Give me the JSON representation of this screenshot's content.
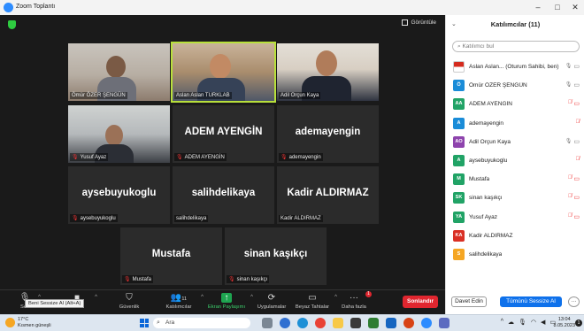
{
  "window": {
    "title": "Zoom Toplantı"
  },
  "meeting": {
    "view_label": "Görüntüle",
    "tiles": [
      {
        "id": "t1",
        "label": "Ömür ÖZER ŞENGÜN",
        "video": true
      },
      {
        "id": "t2",
        "label": "Aslan Aslan TURKLAB",
        "video": true,
        "active": true
      },
      {
        "id": "t3",
        "label": "Adil Orçun Kaya",
        "video": true
      },
      {
        "id": "t4",
        "label": "Yusuf Ayaz",
        "video": true,
        "muted": true
      },
      {
        "id": "t5",
        "big": "ADEM AYENGİN",
        "label": "ADEM AYENGİN",
        "muted": true
      },
      {
        "id": "t6",
        "big": "ademayengin",
        "label": "ademayengin",
        "muted": true
      },
      {
        "id": "t7",
        "big": "aysebuyukoglu",
        "label": "aysebuyukoglu",
        "muted": true
      },
      {
        "id": "t8",
        "big": "salihdelikaya",
        "label": "salihdelikaya"
      },
      {
        "id": "t9",
        "big": "Kadir ALDIRMAZ",
        "label": "Kadir ALDIRMAZ"
      },
      {
        "id": "t10",
        "big": "Mustafa",
        "label": "Mustafa",
        "muted": true
      },
      {
        "id": "t11",
        "big": "sinan kaşıkçı",
        "label": "sinan kaşıkçı",
        "muted": true
      }
    ]
  },
  "toolbar": {
    "mute_label": "Ses",
    "video_label": "or",
    "tooltip": "Beni Sessize Al (Alt+A)",
    "security_label": "Güvenlik",
    "participants_label": "Katılımcılar",
    "participants_count": "11",
    "share_label": "Ekran Paylaşımı",
    "apps_label": "Uygulamalar",
    "whiteboard_label": "Beyaz Tahtalar",
    "more_label": "Daha fazla",
    "more_badge": "1",
    "end_label": "Sonlandır"
  },
  "panel": {
    "title": "Katılımcılar (11)",
    "search_placeholder": "Katılımcı bul",
    "participants": [
      {
        "initials": "",
        "name": "Aslan Aslan... (Oturum Sahibi, ben)",
        "color": "#ffffff",
        "flag": true,
        "mic": "on",
        "cam": "off"
      },
      {
        "initials": "Ö",
        "name": "Ömür ÖZER ŞENGÜN",
        "color": "#1a8cd8",
        "mic": "on",
        "cam": "off"
      },
      {
        "initials": "AA",
        "name": "ADEM AYENGİN",
        "color": "#21a366",
        "mic": "muted",
        "cam": "muted"
      },
      {
        "initials": "A",
        "name": "ademayengin",
        "color": "#1a8cd8",
        "mic": "muted",
        "cam": ""
      },
      {
        "initials": "AO",
        "name": "Adil Orçun Kaya",
        "color": "#8e44ad",
        "mic": "on",
        "cam": "off"
      },
      {
        "initials": "A",
        "name": "aysebuyukoglu",
        "color": "#21a366",
        "mic": "muted",
        "cam": ""
      },
      {
        "initials": "M",
        "name": "Mustafa",
        "color": "#21a366",
        "mic": "muted",
        "cam": "muted"
      },
      {
        "initials": "SK",
        "name": "sinan kaşıkçı",
        "color": "#21a366",
        "mic": "muted",
        "cam": "muted"
      },
      {
        "initials": "YA",
        "name": "Yusuf Ayaz",
        "color": "#21a366",
        "mic": "muted",
        "cam": "muted"
      },
      {
        "initials": "KA",
        "name": "Kadir ALDIRMAZ",
        "color": "#d93025",
        "mic": "",
        "cam": ""
      },
      {
        "initials": "S",
        "name": "salihdelikaya",
        "color": "#f5a623",
        "mic": "",
        "cam": ""
      }
    ],
    "invite_label": "Davet Edin",
    "mute_all_label": "Tümünü Sessize Al",
    "more_label": "···"
  },
  "taskbar": {
    "temp": "17°C",
    "weather": "Kısmen güneşli",
    "search_placeholder": "Ara",
    "time": "13:04",
    "date": "8.05.2023",
    "notification_count": "1"
  }
}
